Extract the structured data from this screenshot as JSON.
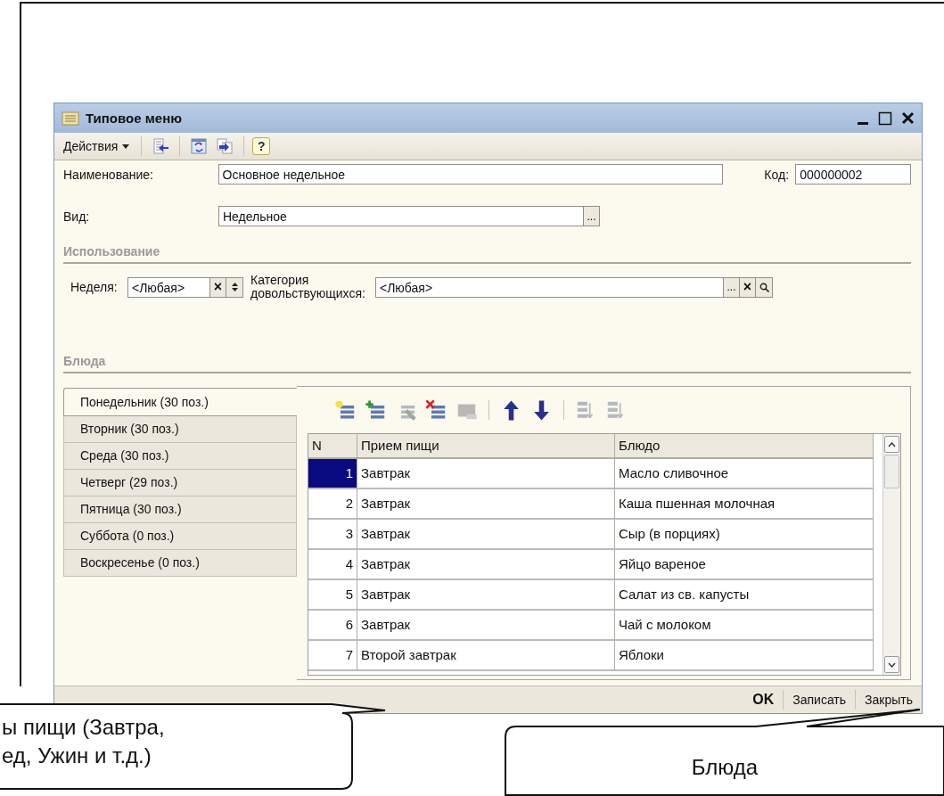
{
  "window": {
    "title": "Типовое меню"
  },
  "toolbar": {
    "actions_menu": "Действия",
    "tools": [
      {
        "kind": "fill-back"
      },
      {
        "kind": "refresh"
      },
      {
        "kind": "copy-arrow"
      }
    ],
    "help": "?"
  },
  "fields": {
    "name": {
      "label": "Наименование:",
      "value": "Основное недельное"
    },
    "code": {
      "label": "Код:",
      "value": "000000002"
    },
    "type": {
      "label": "Вид:",
      "value": "Недельное",
      "select": "..."
    }
  },
  "usage": {
    "title": "Использование",
    "week": {
      "label": "Неделя:",
      "value": "<Любая>",
      "clear": "×"
    },
    "category": {
      "label": "Категория довольствующихся:",
      "value": "<Любая>",
      "select": "...",
      "clear": "×"
    }
  },
  "dishes": {
    "title": "Блюда",
    "tabs": [
      {
        "label": "Понедельник (30 поз.)",
        "selected": true
      },
      {
        "label": "Вторник (30 поз.)",
        "selected": false
      },
      {
        "label": "Среда (30 поз.)",
        "selected": false
      },
      {
        "label": "Четверг (29 поз.)",
        "selected": false
      },
      {
        "label": "Пятница (30 поз.)",
        "selected": false
      },
      {
        "label": "Суббота (0 поз.)",
        "selected": false
      },
      {
        "label": "Воскресенье (0 поз.)",
        "selected": false
      }
    ],
    "tools": [
      {
        "kind": "add",
        "disabled": false
      },
      {
        "kind": "add-copy",
        "disabled": false
      },
      {
        "kind": "edit",
        "disabled": true
      },
      {
        "kind": "delete",
        "disabled": false
      },
      {
        "kind": "end-edit",
        "disabled": true
      },
      {
        "kind": "move-up",
        "disabled": false
      },
      {
        "kind": "move-down",
        "disabled": false
      },
      {
        "kind": "sort-asc",
        "disabled": true
      },
      {
        "kind": "sort-desc",
        "disabled": true
      }
    ],
    "table": {
      "columns": [
        "N",
        "Прием пищи",
        "Блюдо"
      ],
      "rows": [
        {
          "n": "1",
          "meal": "Завтрак",
          "dish": "Масло сливочное",
          "selected": true
        },
        {
          "n": "2",
          "meal": "Завтрак",
          "dish": "Каша пшенная молочная",
          "selected": false
        },
        {
          "n": "3",
          "meal": "Завтрак",
          "dish": "Сыр (в порциях)",
          "selected": false
        },
        {
          "n": "4",
          "meal": "Завтрак",
          "dish": "Яйцо вареное",
          "selected": false
        },
        {
          "n": "5",
          "meal": "Завтрак",
          "dish": "Салат из св. капусты",
          "selected": false
        },
        {
          "n": "6",
          "meal": "Завтрак",
          "dish": "Чай с молоком",
          "selected": false
        },
        {
          "n": "7",
          "meal": "Второй завтрак",
          "dish": "Яблоки",
          "selected": false
        }
      ]
    }
  },
  "footer_buttons": [
    {
      "label": "OK",
      "default": true
    },
    {
      "label": "Записать",
      "default": false
    },
    {
      "label": "Закрыть",
      "default": false
    }
  ],
  "callouts": [
    {
      "lines": [
        "ы пищи (Завтра,",
        "ед, Ужин и т.д.)"
      ]
    },
    {
      "lines": [
        "Блюда"
      ]
    }
  ]
}
